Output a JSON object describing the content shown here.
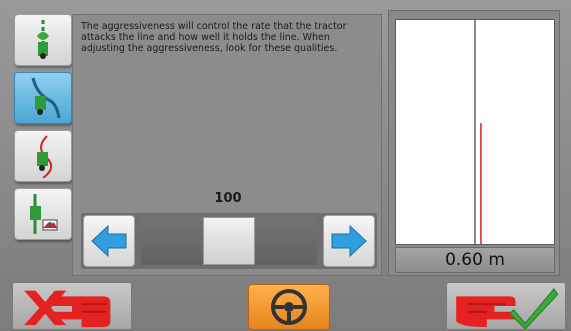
{
  "help": {
    "text": "The aggressiveness will control the rate that the tractor attacks the line and how well it holds the line. When adjusting the aggressiveness, look for these qualities."
  },
  "slider": {
    "value_label": "100",
    "position_fraction": 0.5
  },
  "steering_plot": {
    "offset_text": "0.60 m"
  },
  "mode_icons": [
    {
      "icon": "tractor-line-icon",
      "active": false
    },
    {
      "icon": "tractor-curve-icon",
      "active": true
    },
    {
      "icon": "tractor-path-icon",
      "active": false
    },
    {
      "icon": "tractor-camera-icon",
      "active": false
    }
  ],
  "colors": {
    "active_blue": "#4aa6d6",
    "arrow_blue": "#2f9fe0",
    "cancel_red": "#e52222",
    "ok_green": "#3aa83a",
    "steer_orange": "#ef8c1e",
    "plot_line_red": "#d42020"
  }
}
